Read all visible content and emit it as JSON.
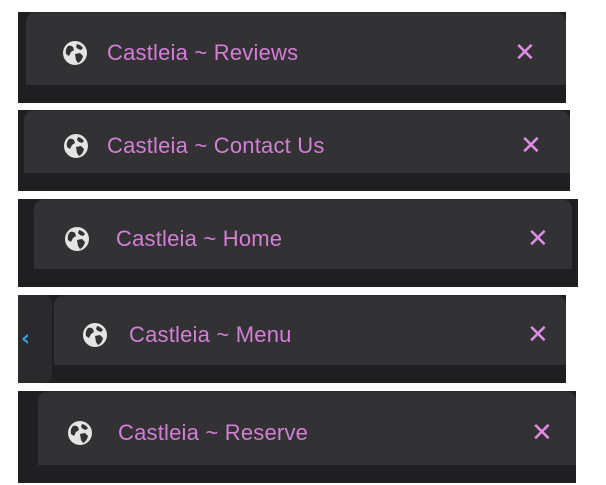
{
  "tabs": [
    {
      "title": "Castleia ~ Reviews",
      "favicon": "globe-icon",
      "close": "✕"
    },
    {
      "title": "Castleia ~ Contact Us",
      "favicon": "globe-icon",
      "close": "✕"
    },
    {
      "title": "Castleia ~ Home",
      "favicon": "globe-icon",
      "close": "✕"
    },
    {
      "title": "Castleia ~ Menu",
      "favicon": "globe-icon",
      "close": "✕"
    },
    {
      "title": "Castleia ~ Reserve",
      "favicon": "globe-icon",
      "close": "✕"
    }
  ],
  "scroll_left_glyph": "‹",
  "colors": {
    "tab_background": "#323234",
    "strip_background": "#1f1f21",
    "title_text": "#d47ed6",
    "close_icon": "#e08be6",
    "scroll_arrow": "#3aa0e0"
  }
}
